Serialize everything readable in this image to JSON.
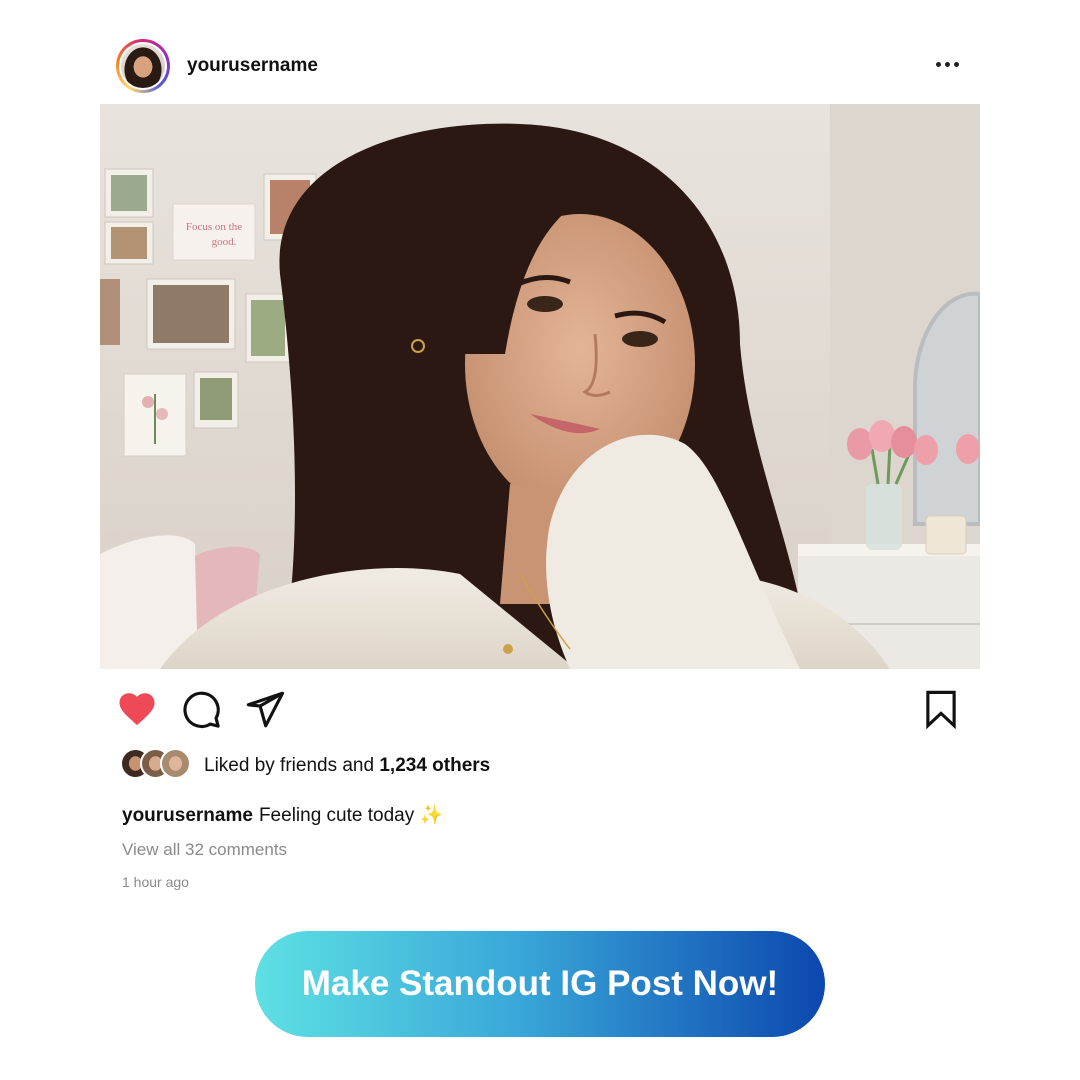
{
  "post": {
    "username": "yourusername",
    "more_icon": "more-horizontal-icon",
    "photo_sign_text": "Focus on the good.",
    "liked_prefix": "Liked by friends and ",
    "liked_count": "1,234 others",
    "caption_user": "yourusername",
    "caption_text": "Feeling cute today ",
    "caption_emoji": "✨",
    "view_comments": "View all 32 comments",
    "time_ago": "1 hour ago",
    "icons": [
      "heart-icon",
      "comment-icon",
      "share-icon",
      "bookmark-icon"
    ],
    "colors": {
      "heart": "#ed4956",
      "text": "#111111",
      "muted": "#8a8a8a"
    }
  },
  "cta": {
    "label": "Make Standout IG Post Now!",
    "gradient_start": "#5ee0e3",
    "gradient_end": "#0c47ae"
  }
}
